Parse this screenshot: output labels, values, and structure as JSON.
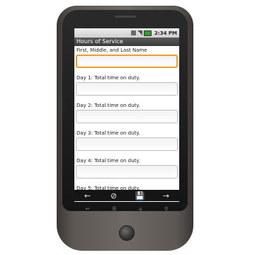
{
  "status": {
    "time": "2:34 PM"
  },
  "app": {
    "title": "Hours of Service"
  },
  "form": {
    "name_label": "First, Middle, and Last Name",
    "name_value": "",
    "day_labels": [
      "Day 1: Total time on duty.",
      "Day 2: Total time on duty.",
      "Day 3: Total time on duty.",
      "Day 4: Total time on duty.",
      "Day 5: Total time on duty."
    ]
  },
  "navbar": {
    "back": "←",
    "cancel": "⊘",
    "save": "💾",
    "forward": "→"
  },
  "hw_keys": {
    "back": "↩",
    "menu": "☰",
    "home": "⌂",
    "search": "⚲"
  }
}
